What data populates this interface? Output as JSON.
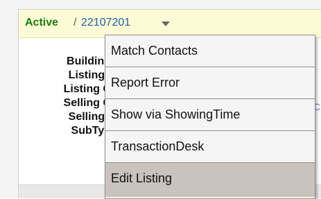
{
  "header": {
    "status": "Active",
    "separator": "/",
    "listing_number": "22107201"
  },
  "fields": [
    "Building",
    "Listing I",
    "Listing C",
    "Selling C",
    "Selling I",
    "SubTyp"
  ],
  "edge_glyph": "C",
  "menu": {
    "items": [
      "Match Contacts",
      "Report Error",
      "Show via ShowingTime",
      "TransactionDesk",
      "Edit Listing"
    ],
    "highlighted": "Edit Listing"
  },
  "icons": {
    "caret": "chevron-down-icon"
  }
}
